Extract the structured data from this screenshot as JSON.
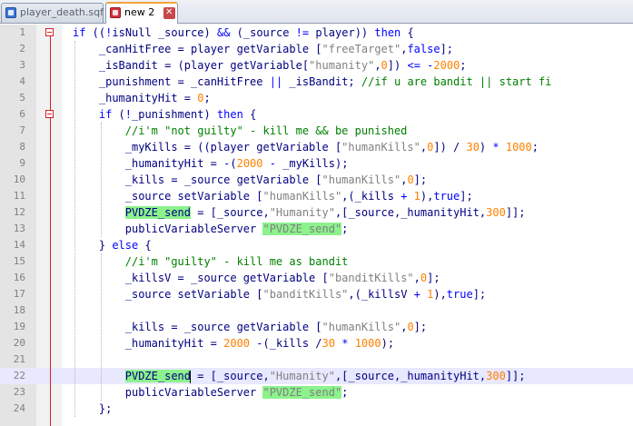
{
  "tabs": [
    {
      "label": "player_death.sqf",
      "active": false,
      "icon": "file-saved-icon"
    },
    {
      "label": "new  2",
      "active": true,
      "icon": "file-modified-icon"
    }
  ],
  "colors": {
    "keyword": "#0000ff",
    "number": "#ff8000",
    "string": "#808080",
    "comment": "#008000",
    "highlight": "#8cf28c",
    "fold_marker": "#d4212a",
    "current_line": "#e8e8ff"
  },
  "editor": {
    "current_line": 22,
    "lines": [
      {
        "n": "1",
        "indent": 0,
        "tokens": [
          [
            "kw",
            "if"
          ],
          [
            "t",
            " (("
          ],
          [
            "kw",
            "!"
          ],
          [
            "t",
            "isNull _source) "
          ],
          [
            "kw",
            "&&"
          ],
          [
            "t",
            " (_source "
          ],
          [
            "kw",
            "!="
          ],
          [
            "t",
            " player)) "
          ],
          [
            "kw",
            "then"
          ],
          [
            "t",
            " {"
          ]
        ]
      },
      {
        "n": "2",
        "indent": 1,
        "tokens": [
          [
            "t",
            "_canHitFree = player getVariable ["
          ],
          [
            "str",
            "\"freeTarget\""
          ],
          [
            "t",
            ","
          ],
          [
            "kw",
            "false"
          ],
          [
            "t",
            "];"
          ]
        ]
      },
      {
        "n": "3",
        "indent": 1,
        "tokens": [
          [
            "t",
            "_isBandit = (player getVariable["
          ],
          [
            "str",
            "\"humanity\""
          ],
          [
            "t",
            ","
          ],
          [
            "num",
            "0"
          ],
          [
            "t",
            "]) "
          ],
          [
            "kw",
            "<="
          ],
          [
            "t",
            " "
          ],
          [
            "kw",
            "-"
          ],
          [
            "num",
            "2000"
          ],
          [
            "t",
            ";"
          ]
        ]
      },
      {
        "n": "4",
        "indent": 1,
        "tokens": [
          [
            "t",
            "_punishment = _canHitFree "
          ],
          [
            "kw",
            "||"
          ],
          [
            "t",
            " _isBandit; "
          ],
          [
            "cmt",
            "//if u are bandit || start fi"
          ]
        ]
      },
      {
        "n": "5",
        "indent": 1,
        "tokens": [
          [
            "t",
            "_humanityHit = "
          ],
          [
            "num",
            "0"
          ],
          [
            "t",
            ";"
          ]
        ]
      },
      {
        "n": "6",
        "indent": 1,
        "tokens": [
          [
            "kw",
            "if"
          ],
          [
            "t",
            " ("
          ],
          [
            "kw",
            "!"
          ],
          [
            "t",
            "_punishment) "
          ],
          [
            "kw",
            "then"
          ],
          [
            "t",
            " {"
          ]
        ]
      },
      {
        "n": "7",
        "indent": 2,
        "tokens": [
          [
            "cmt",
            "//i'm \"not guilty\" - kill me && be punished"
          ]
        ]
      },
      {
        "n": "8",
        "indent": 2,
        "tokens": [
          [
            "t",
            "_myKills = ((player getVariable ["
          ],
          [
            "str",
            "\"humanKills\""
          ],
          [
            "t",
            ","
          ],
          [
            "num",
            "0"
          ],
          [
            "t",
            "]) / "
          ],
          [
            "num",
            "30"
          ],
          [
            "t",
            ") "
          ],
          [
            "kw",
            "*"
          ],
          [
            "t",
            " "
          ],
          [
            "num",
            "1000"
          ],
          [
            "t",
            ";"
          ]
        ]
      },
      {
        "n": "9",
        "indent": 2,
        "tokens": [
          [
            "t",
            "_humanityHit = "
          ],
          [
            "kw",
            "-"
          ],
          [
            "t",
            "("
          ],
          [
            "num",
            "2000"
          ],
          [
            "t",
            " "
          ],
          [
            "kw",
            "-"
          ],
          [
            "t",
            " _myKills);"
          ]
        ]
      },
      {
        "n": "10",
        "indent": 2,
        "tokens": [
          [
            "t",
            "_kills = _source getVariable ["
          ],
          [
            "str",
            "\"humanKills\""
          ],
          [
            "t",
            ","
          ],
          [
            "num",
            "0"
          ],
          [
            "t",
            "];"
          ]
        ]
      },
      {
        "n": "11",
        "indent": 2,
        "tokens": [
          [
            "t",
            "_source setVariable ["
          ],
          [
            "str",
            "\"humanKills\""
          ],
          [
            "t",
            ",(_kills "
          ],
          [
            "kw",
            "+"
          ],
          [
            "t",
            " "
          ],
          [
            "num",
            "1"
          ],
          [
            "t",
            "),"
          ],
          [
            "kw",
            "true"
          ],
          [
            "t",
            "];"
          ]
        ]
      },
      {
        "n": "12",
        "indent": 2,
        "tokens": [
          [
            "hl",
            "PVDZE_send"
          ],
          [
            "t",
            " = [_source,"
          ],
          [
            "str",
            "\"Humanity\""
          ],
          [
            "t",
            ",[_source,_humanityHit,"
          ],
          [
            "num",
            "300"
          ],
          [
            "t",
            "]];"
          ]
        ]
      },
      {
        "n": "13",
        "indent": 2,
        "tokens": [
          [
            "t",
            "publicVariableServer "
          ],
          [
            "hlstr",
            "\"PVDZE_send\""
          ],
          [
            "t",
            ";"
          ]
        ]
      },
      {
        "n": "14",
        "indent": 1,
        "tokens": [
          [
            "t",
            "} "
          ],
          [
            "kw",
            "else"
          ],
          [
            "t",
            " {"
          ]
        ]
      },
      {
        "n": "15",
        "indent": 2,
        "tokens": [
          [
            "cmt",
            "//i'm \"guilty\" - kill me as bandit"
          ]
        ]
      },
      {
        "n": "16",
        "indent": 2,
        "tokens": [
          [
            "t",
            "_killsV = _source getVariable ["
          ],
          [
            "str",
            "\"banditKills\""
          ],
          [
            "t",
            ","
          ],
          [
            "num",
            "0"
          ],
          [
            "t",
            "];"
          ]
        ]
      },
      {
        "n": "17",
        "indent": 2,
        "tokens": [
          [
            "t",
            "_source setVariable ["
          ],
          [
            "str",
            "\"banditKills\""
          ],
          [
            "t",
            ",(_killsV "
          ],
          [
            "kw",
            "+"
          ],
          [
            "t",
            " "
          ],
          [
            "num",
            "1"
          ],
          [
            "t",
            "),"
          ],
          [
            "kw",
            "true"
          ],
          [
            "t",
            "];"
          ]
        ]
      },
      {
        "n": "18",
        "indent": 0,
        "tokens": []
      },
      {
        "n": "19",
        "indent": 2,
        "tokens": [
          [
            "t",
            "_kills = _source getVariable ["
          ],
          [
            "str",
            "\"humanKills\""
          ],
          [
            "t",
            ","
          ],
          [
            "num",
            "0"
          ],
          [
            "t",
            "];"
          ]
        ]
      },
      {
        "n": "20",
        "indent": 2,
        "tokens": [
          [
            "t",
            "_humanityHit = "
          ],
          [
            "num",
            "2000"
          ],
          [
            "t",
            " "
          ],
          [
            "kw",
            "-"
          ],
          [
            "t",
            "(_kills /"
          ],
          [
            "num",
            "30"
          ],
          [
            "t",
            " "
          ],
          [
            "kw",
            "*"
          ],
          [
            "t",
            " "
          ],
          [
            "num",
            "1000"
          ],
          [
            "t",
            ");"
          ]
        ]
      },
      {
        "n": "21",
        "indent": 0,
        "tokens": []
      },
      {
        "n": "22",
        "indent": 2,
        "tokens": [
          [
            "hl",
            "PVDZE_send"
          ],
          [
            "caret",
            ""
          ],
          [
            "t",
            " = [_source,"
          ],
          [
            "str",
            "\"Humanity\""
          ],
          [
            "t",
            ",[_source,_humanityHit,"
          ],
          [
            "num",
            "300"
          ],
          [
            "t",
            "]];"
          ]
        ]
      },
      {
        "n": "23",
        "indent": 2,
        "tokens": [
          [
            "t",
            "publicVariableServer "
          ],
          [
            "hlstr",
            "\"PVDZE_send\""
          ],
          [
            "t",
            ";"
          ]
        ]
      },
      {
        "n": "24",
        "indent": 1,
        "tokens": [
          [
            "t",
            "};"
          ]
        ]
      }
    ]
  }
}
